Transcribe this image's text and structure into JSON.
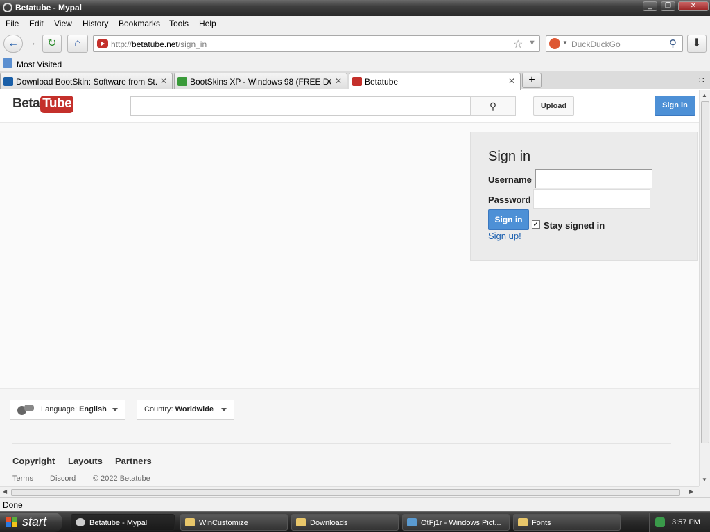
{
  "window": {
    "title": "Betatube - Mypal"
  },
  "menu": [
    "File",
    "Edit",
    "View",
    "History",
    "Bookmarks",
    "Tools",
    "Help"
  ],
  "navbar": {
    "url_prefix": "http://",
    "url_host": "betatube.net",
    "url_path": "/sign_in",
    "search_placeholder": "DuckDuckGo"
  },
  "bookmarks": {
    "most_visited": "Most Visited"
  },
  "tabs": [
    {
      "label": "Download BootSkin: Software from St...",
      "icon_color": "#1a5fa8",
      "active": false
    },
    {
      "label": "BootSkins XP - Windows 98 (FREE DO...",
      "icon_color": "#3a9a3a",
      "active": false
    },
    {
      "label": "Betatube",
      "icon_color": "#c4302b",
      "active": true
    }
  ],
  "site": {
    "logo_beta": "Beta",
    "logo_tube": "Tube",
    "upload": "Upload",
    "signin_top": "Sign in"
  },
  "signin": {
    "heading": "Sign in",
    "username_label": "Username",
    "password_label": "Password",
    "button": "Sign in",
    "stay_signed_in": "Stay signed in",
    "stay_checked": true,
    "signup": "Sign up!"
  },
  "footer": {
    "language_prefix": "Language:",
    "language_value": "English",
    "country_prefix": "Country:",
    "country_value": "Worldwide",
    "links": [
      "Copyright",
      "Layouts",
      "Partners"
    ],
    "small_links": [
      "Terms",
      "Discord",
      "© 2022 Betatube"
    ]
  },
  "status": {
    "text": "Done"
  },
  "taskbar": {
    "start": "start",
    "tasks": [
      "Betatube - Mypal",
      "WinCustomize",
      "Downloads",
      "OtFj1r - Windows Pict...",
      "Fonts"
    ],
    "clock": "3:57 PM"
  },
  "colors": {
    "accent": "#4d90d6",
    "brand": "#c4302b"
  }
}
